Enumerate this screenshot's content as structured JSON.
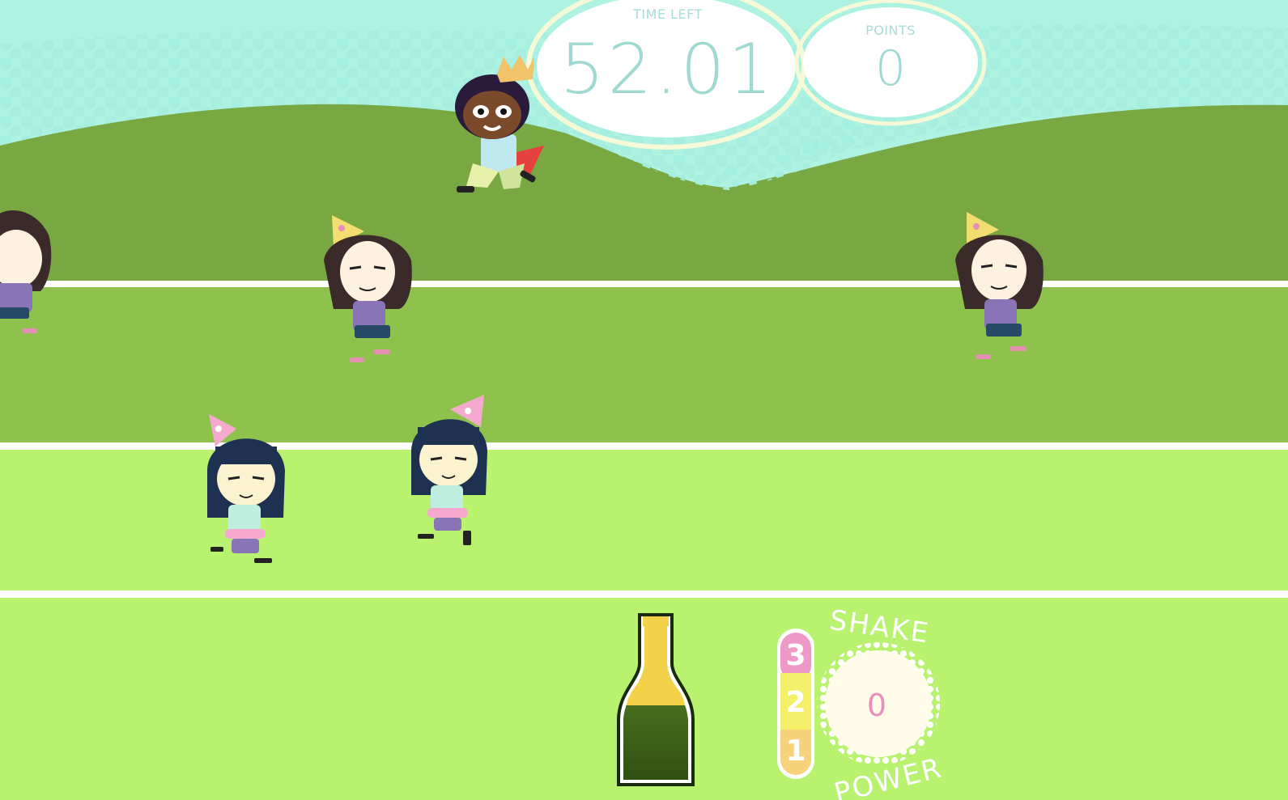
{
  "hud": {
    "time_left_label": "TIME LEFT",
    "time_left_value": "52.01",
    "points_label": "POINTS",
    "points_value": "0"
  },
  "bottle": {
    "value": "0"
  },
  "shake_meter": {
    "levels": [
      "3",
      "2",
      "1"
    ],
    "title_top": "SHAKE",
    "title_bottom": "POWER",
    "value": "0"
  },
  "colors": {
    "sky": "#aef2e2",
    "dots": "#a6eee0",
    "hill": "#79a843",
    "lane_far": "#8fc24d",
    "lane_near": "#b8f26e",
    "lane_line": "#ffffff",
    "hud_text": "#9fd9d1",
    "meter_pink": "#ef99c9",
    "meter_yellow": "#f4f06a",
    "meter_orange": "#f6d27a",
    "shake_value": "#e88fbd"
  },
  "characters": [
    {
      "role": "player",
      "hair": "black curly",
      "accessory": "crown-icon",
      "cape": "red"
    },
    {
      "role": "runner",
      "hair": "brown",
      "accessory": "party-hat-icon"
    },
    {
      "role": "runner",
      "hair": "brown",
      "accessory": "party-hat-icon"
    },
    {
      "role": "runner",
      "hair": "brown",
      "accessory": "party-hat-icon"
    },
    {
      "role": "runner",
      "hair": "navy bob",
      "accessory": "party-hat-icon"
    },
    {
      "role": "runner",
      "hair": "navy bob",
      "accessory": "party-hat-icon"
    }
  ]
}
